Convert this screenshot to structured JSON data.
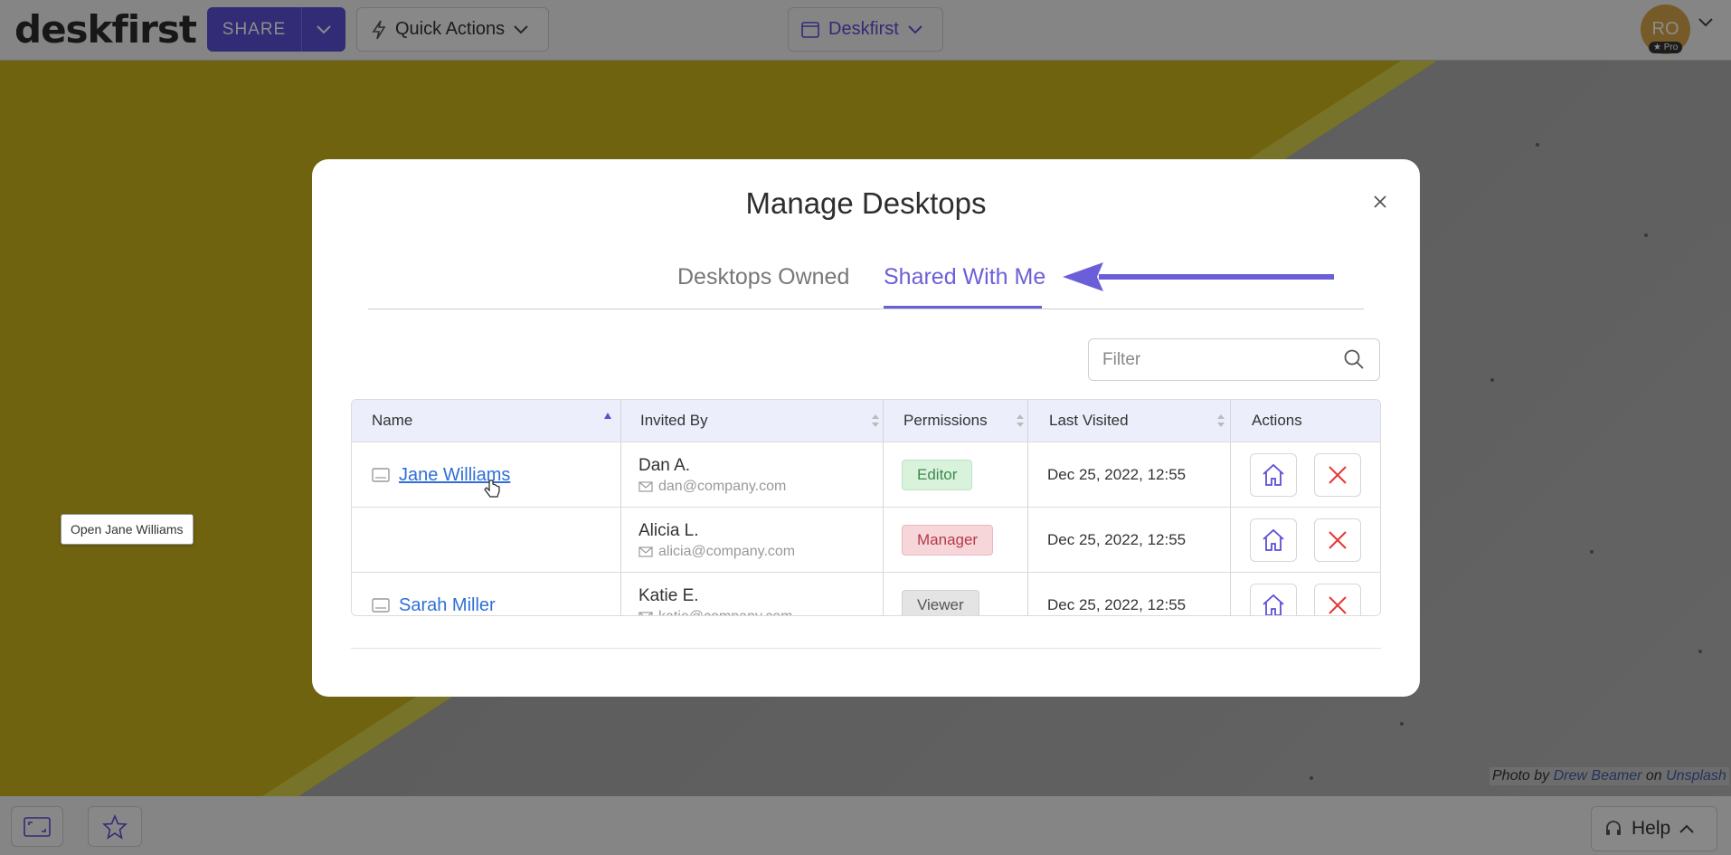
{
  "app": {
    "logo": "deskfirst"
  },
  "topbar": {
    "share_label": "SHARE",
    "quick_actions_label": "Quick Actions",
    "workspace_label": "Deskfirst",
    "avatar_initials": "RO",
    "pro_badge": "Pro"
  },
  "modal": {
    "title": "Manage Desktops",
    "tabs": [
      {
        "label": "Desktops Owned",
        "active": false
      },
      {
        "label": "Shared With Me",
        "active": true
      }
    ],
    "filter_placeholder": "Filter",
    "columns": [
      "Name",
      "Invited By",
      "Permissions",
      "Last Visited",
      "Actions"
    ],
    "rows": [
      {
        "name": "Jane Williams",
        "invited_name": "Dan A.",
        "invited_email": "dan@company.com",
        "permission": "Editor",
        "last_visited": "Dec 25, 2022, 12:55"
      },
      {
        "name": "",
        "invited_name": "Alicia L.",
        "invited_email": "alicia@company.com",
        "permission": "Manager",
        "last_visited": "Dec 25, 2022, 12:55"
      },
      {
        "name": "Sarah Miller",
        "invited_name": "Katie E.",
        "invited_email": "katie@company.com",
        "permission": "Viewer",
        "last_visited": "Dec 25, 2022, 12:55"
      }
    ],
    "tooltip": "Open Jane Williams"
  },
  "credit": {
    "prefix": "Photo by",
    "author": "Drew Beamer",
    "middle": "on",
    "site": "Unsplash"
  },
  "bottombar": {
    "help_label": "Help"
  },
  "colors": {
    "accent": "#5b4fd6",
    "link": "#2f6fd6",
    "danger": "#e53935"
  }
}
